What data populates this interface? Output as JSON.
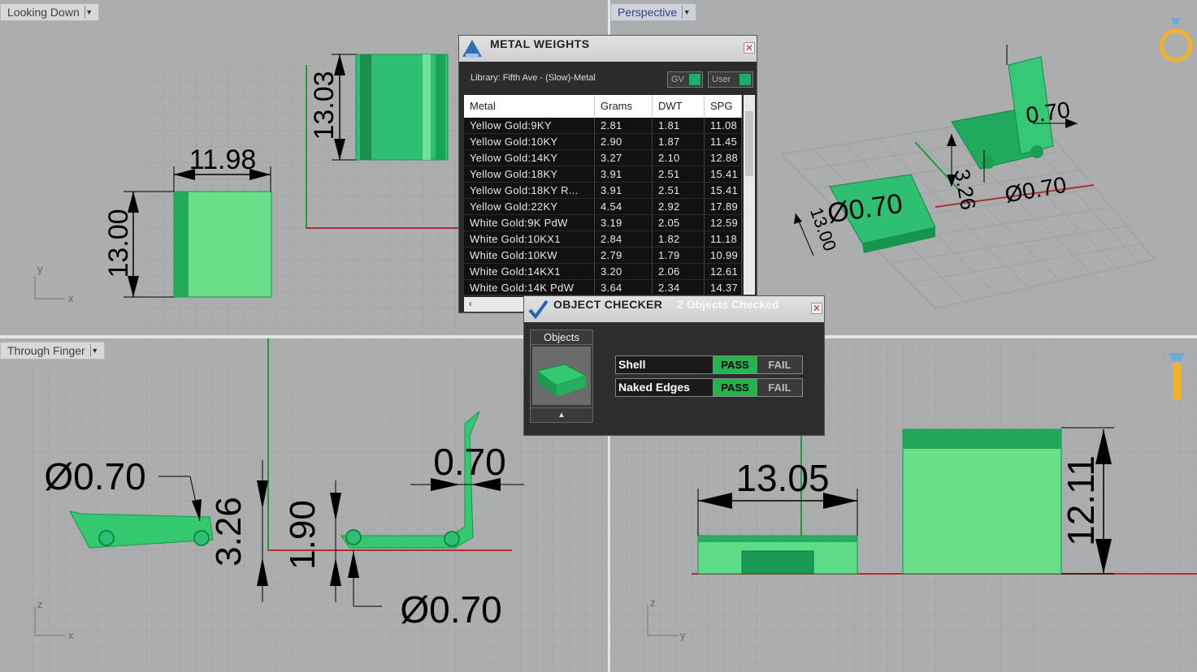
{
  "viewports": {
    "top_left": {
      "label": "Looking Down",
      "axis_y": "y",
      "axis_x": "x",
      "dims": [
        "11.98",
        "13.00",
        "13.03"
      ]
    },
    "top_right": {
      "label": "Perspective",
      "dims": [
        "0.70",
        "Ø0.70",
        "Ø0.70",
        "3.26",
        "13.00"
      ]
    },
    "bottom_left": {
      "label": "Through Finger",
      "axis_y": "z",
      "axis_x": "x",
      "dims": [
        "Ø0.70",
        "3.26",
        "1.90",
        "0.70",
        "Ø0.70"
      ]
    },
    "bottom_right": {
      "axis_y": "z",
      "axis_x": "y",
      "dims": [
        "13.05",
        "12.11"
      ]
    }
  },
  "metal_weights": {
    "title": "METAL WEIGHTS",
    "library": "Library: Fifth Ave - (Slow)-Metal",
    "selector1": "GV",
    "selector2": "User",
    "columns": [
      "Metal",
      "Grams",
      "DWT",
      "SPG"
    ],
    "rows": [
      [
        "Yellow Gold:9KY",
        "2.81",
        "1.81",
        "11.08"
      ],
      [
        "Yellow Gold:10KY",
        "2.90",
        "1.87",
        "11.45"
      ],
      [
        "Yellow Gold:14KY",
        "3.27",
        "2.10",
        "12.88"
      ],
      [
        "Yellow Gold:18KY",
        "3.91",
        "2.51",
        "15.41"
      ],
      [
        "Yellow Gold:18KY R...",
        "3.91",
        "2.51",
        "15.41"
      ],
      [
        "Yellow Gold:22KY",
        "4.54",
        "2.92",
        "17.89"
      ],
      [
        "White Gold:9K PdW",
        "3.19",
        "2.05",
        "12.59"
      ],
      [
        "White Gold:10KX1",
        "2.84",
        "1.82",
        "11.18"
      ],
      [
        "White Gold:10KW",
        "2.79",
        "1.79",
        "10.99"
      ],
      [
        "White Gold:14KX1",
        "3.20",
        "2.06",
        "12.61"
      ],
      [
        "White Gold:14K PdW",
        "3.64",
        "2.34",
        "14.37"
      ]
    ]
  },
  "object_checker": {
    "title": "OBJECT CHECKER",
    "count_text": "2 Objects Checked",
    "objects_label": "Objects",
    "checks": [
      {
        "name": "Shell",
        "pass": "PASS",
        "fail": "FAIL"
      },
      {
        "name": "Naked Edges",
        "pass": "PASS",
        "fail": "FAIL"
      }
    ]
  }
}
